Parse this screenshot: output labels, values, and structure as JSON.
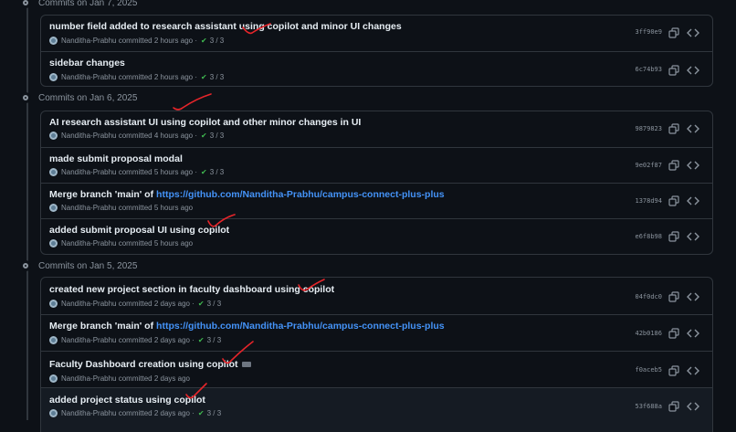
{
  "groups": [
    {
      "date": "Commits on Jan 7, 2025",
      "commits": [
        {
          "title": "number field added to research assistant using copilot and minor UI changes",
          "author": "Nanditha-Prabhu",
          "time": "committed 2 hours ago",
          "checks": "3 / 3",
          "sha": "3ff90e9"
        },
        {
          "title": "sidebar changes",
          "author": "Nanditha-Prabhu",
          "time": "committed 2 hours ago",
          "checks": "3 / 3",
          "sha": "6c74b93"
        }
      ]
    },
    {
      "date": "Commits on Jan 6, 2025",
      "commits": [
        {
          "title": "AI research assistant UI using copilot and other minor changes in UI",
          "author": "Nanditha-Prabhu",
          "time": "committed 4 hours ago",
          "checks": "3 / 3",
          "sha": "9879823"
        },
        {
          "title": "made submit proposal modal",
          "author": "Nanditha-Prabhu",
          "time": "committed 5 hours ago",
          "checks": "3 / 3",
          "sha": "9e02f87"
        },
        {
          "title_prefix": "Merge branch 'main' of",
          "link": "https://github.com/Nanditha-Prabhu/campus-connect-plus-plus",
          "author": "Nanditha-Prabhu",
          "time": "committed 5 hours ago",
          "sha": "1378d94"
        },
        {
          "title": "added submit proposal UI using copilot",
          "author": "Nanditha-Prabhu",
          "time": "committed 5 hours ago",
          "sha": "e6f8b98"
        }
      ]
    },
    {
      "date": "Commits on Jan 5, 2025",
      "commits": [
        {
          "title": "created new project section in faculty dashboard using copilot",
          "author": "Nanditha-Prabhu",
          "time": "committed 2 days ago",
          "checks": "3 / 3",
          "sha": "04f0dc0"
        },
        {
          "title_prefix": "Merge branch 'main' of",
          "link": "https://github.com/Nanditha-Prabhu/campus-connect-plus-plus",
          "author": "Nanditha-Prabhu",
          "time": "committed 2 days ago",
          "checks": "3 / 3",
          "sha": "42b0186"
        },
        {
          "title": "Faculty Dashboard creation using copilot",
          "author": "Nanditha-Prabhu",
          "time": "committed 2 days ago",
          "sha": "f0aceb5"
        },
        {
          "title": "added project status using copilot",
          "author": "Nanditha-Prabhu",
          "time": "committed 2 days ago",
          "checks": "3 / 3",
          "sha": "53f688a"
        }
      ]
    }
  ],
  "icons": {
    "node": "git-commit-icon",
    "copy": "copy-icon",
    "browse": "code-icon",
    "check": "check-icon"
  },
  "colors": {
    "background": "#0d1117",
    "border": "#30363d",
    "muted": "#8b949e",
    "link": "#4493f8",
    "success": "#3fb950",
    "annotation": "#e5252a"
  }
}
